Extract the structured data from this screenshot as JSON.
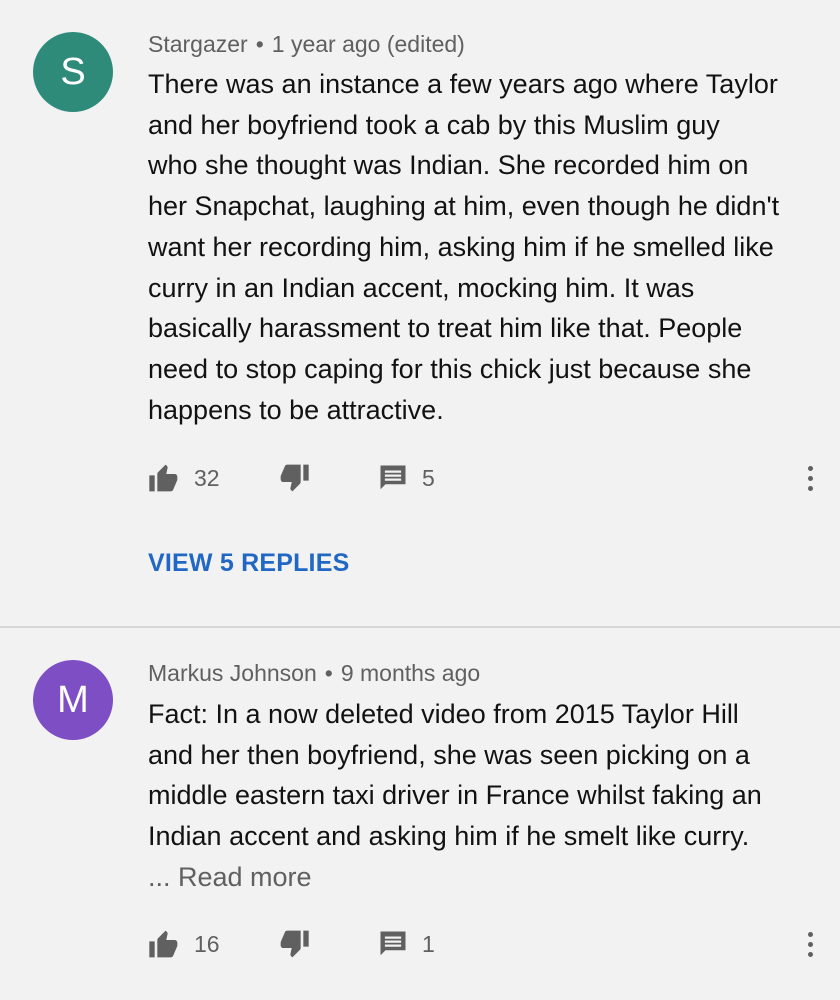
{
  "colors": {
    "background": "#f2f2f2",
    "avatar1": "#2e8b7a",
    "avatar2": "#7e4ec4",
    "link": "#2168c4",
    "icon": "#606060"
  },
  "comments": [
    {
      "avatar_letter": "S",
      "author": "Stargazer",
      "separator": "•",
      "time": "1 year ago (edited)",
      "lines": [
        "There was an instance a few years ago where Taylor",
        "and her boyfriend took a cab by this Muslim guy",
        "who she thought was Indian. She recorded him on",
        "her Snapchat, laughing at him, even though he didn't",
        "want her recording him, asking him if he smelled like",
        "curry in an Indian accent, mocking him. It was",
        "basically harassment to treat him like that. People",
        "need to stop caping for this chick just because she",
        "happens to be attractive."
      ],
      "likes": "32",
      "replies_count": "5",
      "view_replies": "VIEW 5 REPLIES"
    },
    {
      "avatar_letter": "M",
      "author": "Markus Johnson",
      "separator": "•",
      "time": "9 months ago",
      "lines": [
        "Fact: In a now deleted video from 2015 Taylor Hill",
        "and her then boyfriend, she was seen picking on a",
        "middle eastern taxi driver in France whilst faking an",
        "Indian accent and asking him if he smelt like curry."
      ],
      "read_more": "... Read more",
      "likes": "16",
      "replies_count": "1"
    }
  ],
  "icons": {
    "like": "thumbs-up-icon",
    "dislike": "thumbs-down-icon",
    "reply": "comment-icon",
    "more": "more-vert-icon"
  }
}
